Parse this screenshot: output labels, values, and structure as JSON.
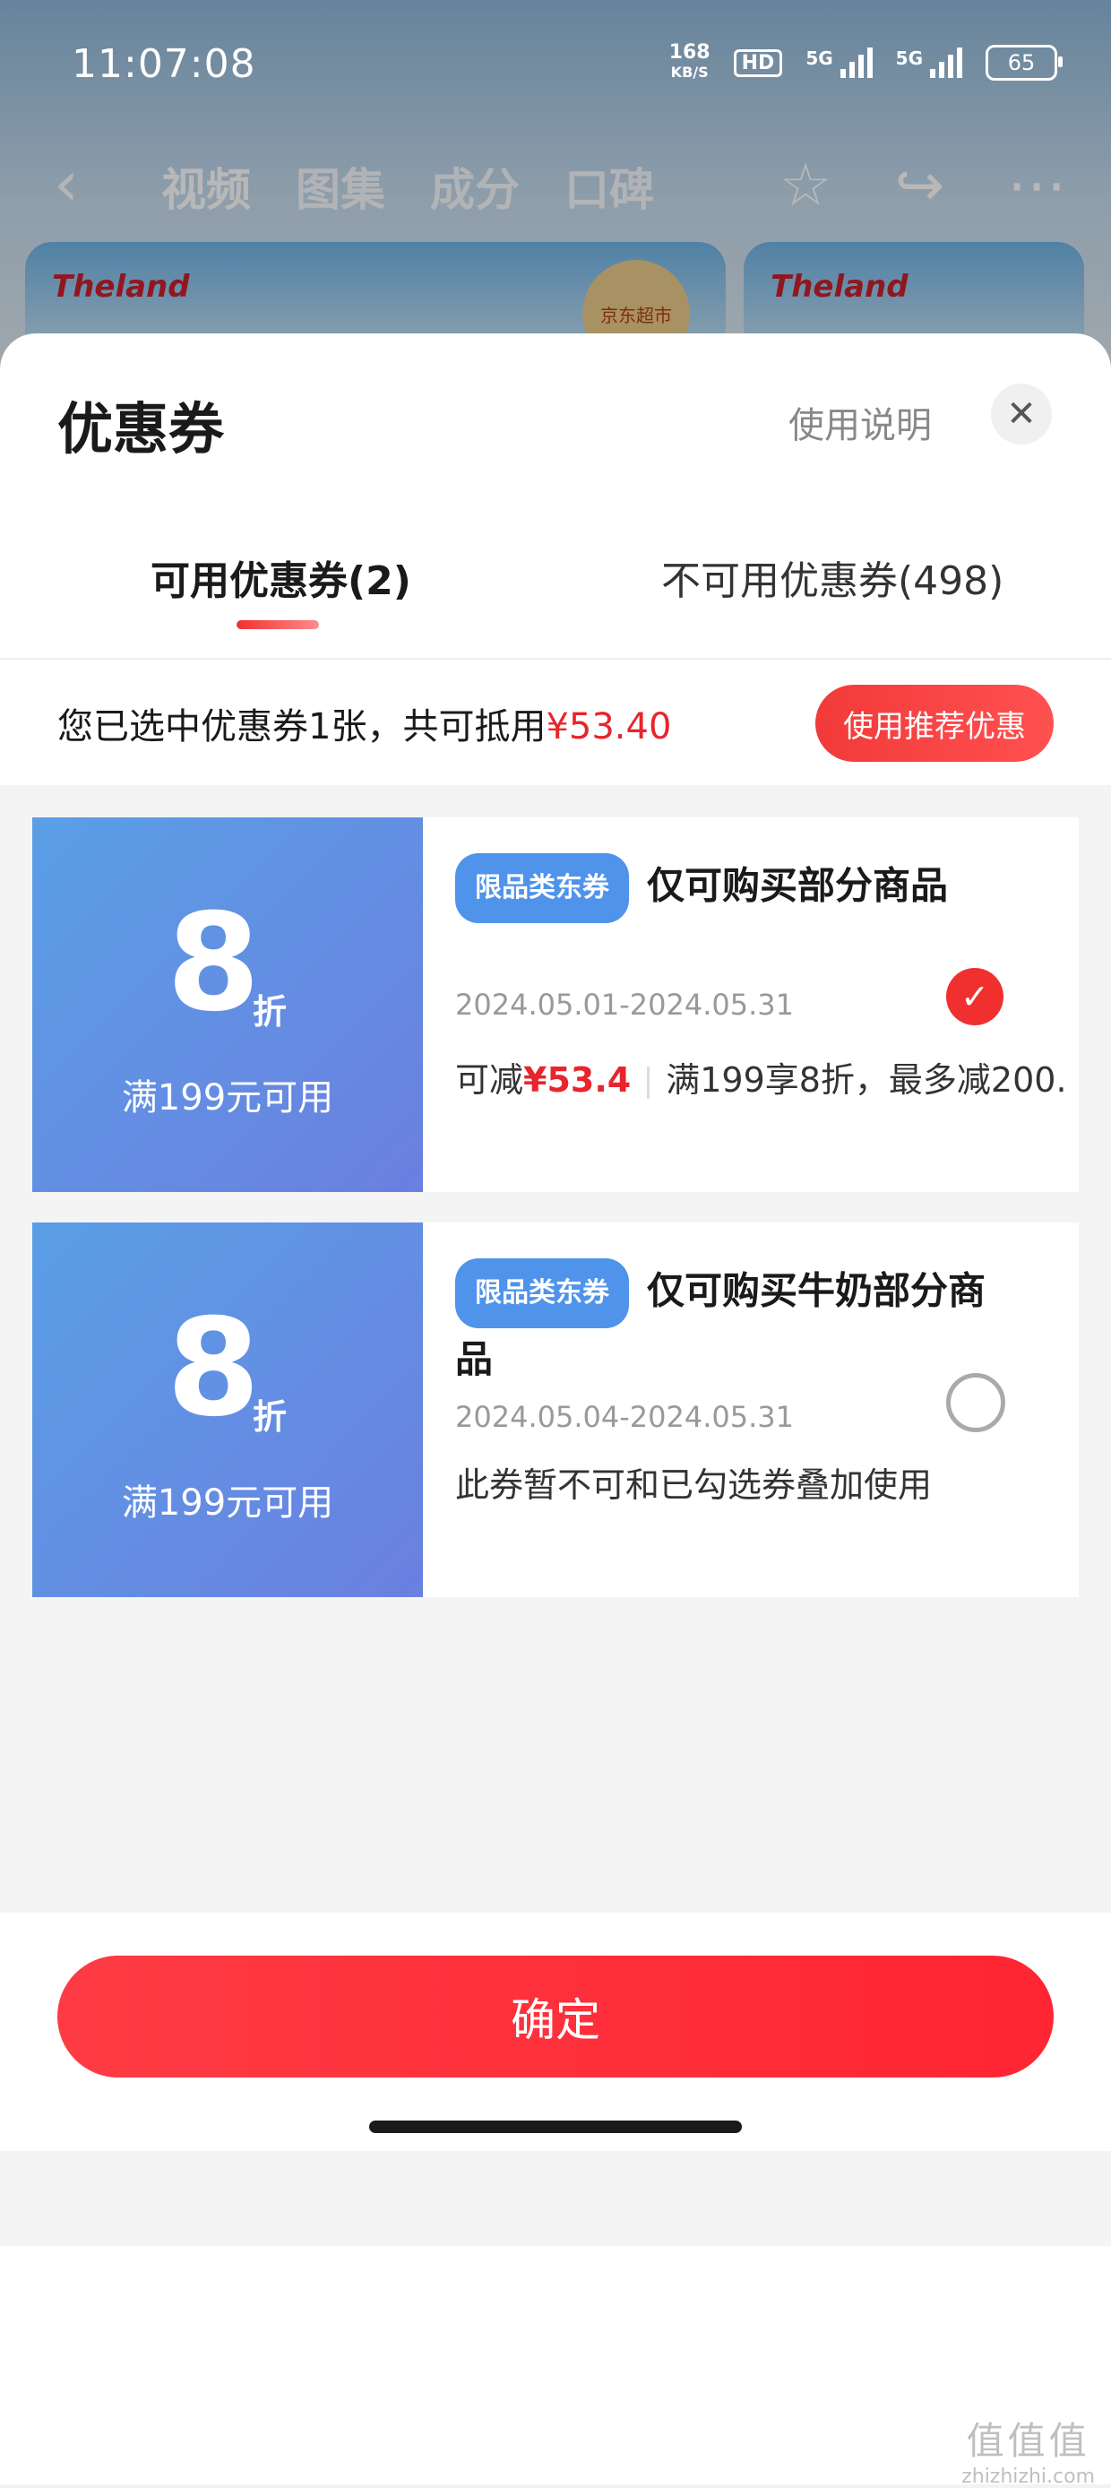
{
  "status_bar": {
    "time": "11:07:08",
    "net_speed_value": "168",
    "net_speed_unit": "KB/S",
    "hd_label": "HD",
    "signal_1_label": "5G",
    "signal_2_label": "5G",
    "battery": "65"
  },
  "background_page": {
    "nav_tabs": [
      "视频",
      "图集",
      "成分",
      "口碑"
    ],
    "brand_logo": "Theland",
    "jd_badge": "京东超市"
  },
  "sheet": {
    "title": "优惠券",
    "help_link": "使用说明",
    "close_icon": "close-icon",
    "tabs": {
      "available": "可用优惠券(2)",
      "unavailable": "不可用优惠券(498)"
    },
    "summary": {
      "text": "您已选中优惠券1张，共可抵用",
      "amount": "¥53.40",
      "recommend_button": "使用推荐优惠"
    },
    "coupons": [
      {
        "discount": "8",
        "unit": "折",
        "condition": "满199元可用",
        "badge": "限品类东券",
        "title": "仅可购买部分商品",
        "date": "2024.05.01-2024.05.31",
        "desc_prefix": "可减",
        "save_amount": "¥53.4",
        "desc_suffix": "满199享8折，最多减200...",
        "selected": true
      },
      {
        "discount": "8",
        "unit": "折",
        "condition": "满199元可用",
        "badge": "限品类东券",
        "title": "仅可购买牛奶部分商品",
        "date": "2024.05.04-2024.05.31",
        "desc": "此券暂不可和已勾选券叠加使用",
        "selected": false
      }
    ],
    "confirm_button": "确定"
  },
  "watermark": {
    "main": "值值值",
    "sub": "zhizhizhi.com"
  },
  "colors": {
    "accent_red": "#f0302e",
    "coupon_blue": "#5a9fe6",
    "badge_blue": "#4f93ea"
  }
}
